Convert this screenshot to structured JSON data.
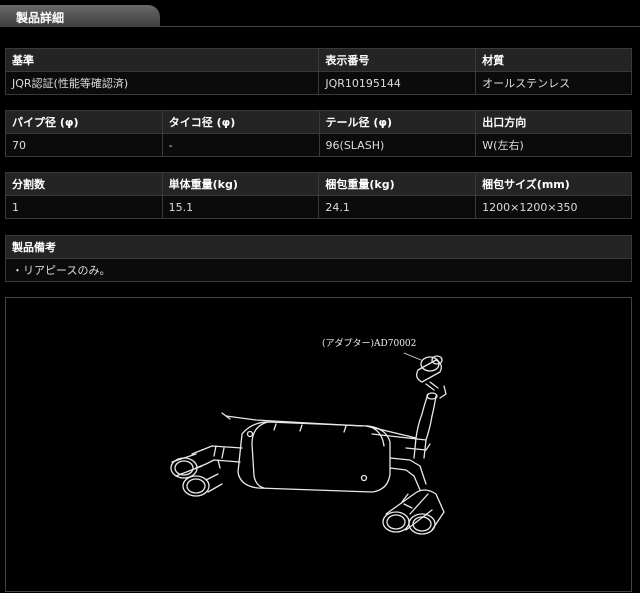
{
  "section_title": "製品詳細",
  "table1": {
    "headers": [
      "基準",
      "表示番号",
      "材質"
    ],
    "values": [
      "JQR認証(性能等確認済)",
      "JQR10195144",
      "オールステンレス"
    ]
  },
  "table2": {
    "headers": [
      "パイプ径 (φ)",
      "タイコ径 (φ)",
      "テール径 (φ)",
      "出口方向"
    ],
    "values": [
      "70",
      "-",
      "96(SLASH)",
      "W(左右)"
    ]
  },
  "table3": {
    "headers": [
      "分割数",
      "単体重量(kg)",
      "梱包重量(kg)",
      "梱包サイズ(mm)"
    ],
    "values": [
      "1",
      "15.1",
      "24.1",
      "1200×1200×350"
    ]
  },
  "remarks": {
    "header": "製品備考",
    "text": "・リアピースのみ。"
  },
  "diagram": {
    "label": "(アダプター)AD70002"
  }
}
